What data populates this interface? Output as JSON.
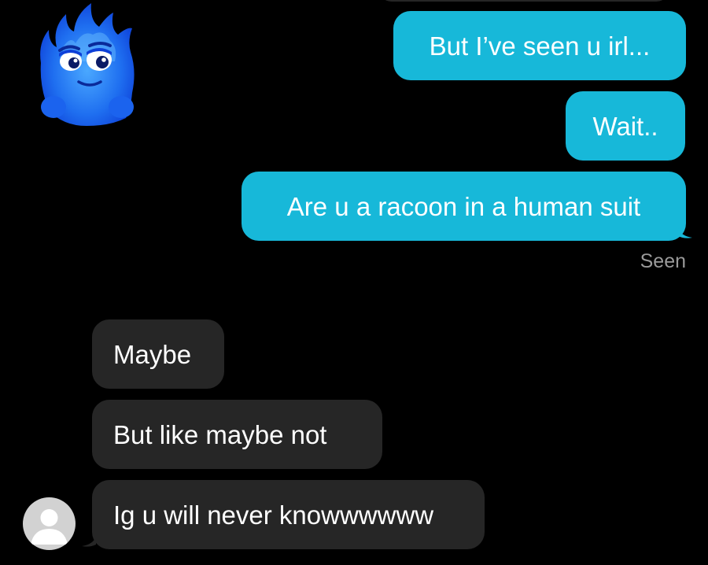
{
  "conversation": {
    "sticker": "blue-flame-character-sticker",
    "sent": [
      {
        "text": "But I’ve seen u irl..."
      },
      {
        "text": "Wait.."
      },
      {
        "text": "Are u a racoon in a human suit"
      }
    ],
    "seen_label": "Seen",
    "received": [
      {
        "text": "Maybe"
      },
      {
        "text": "But like maybe not"
      },
      {
        "text": "Ig u will never knowwwwww"
      }
    ],
    "avatar": "default-profile-avatar"
  },
  "colors": {
    "background": "#000000",
    "sent_bubble": "#17b8d9",
    "received_bubble": "#262626",
    "seen_text": "#9a9a9a",
    "avatar": "#d2d2d2"
  }
}
